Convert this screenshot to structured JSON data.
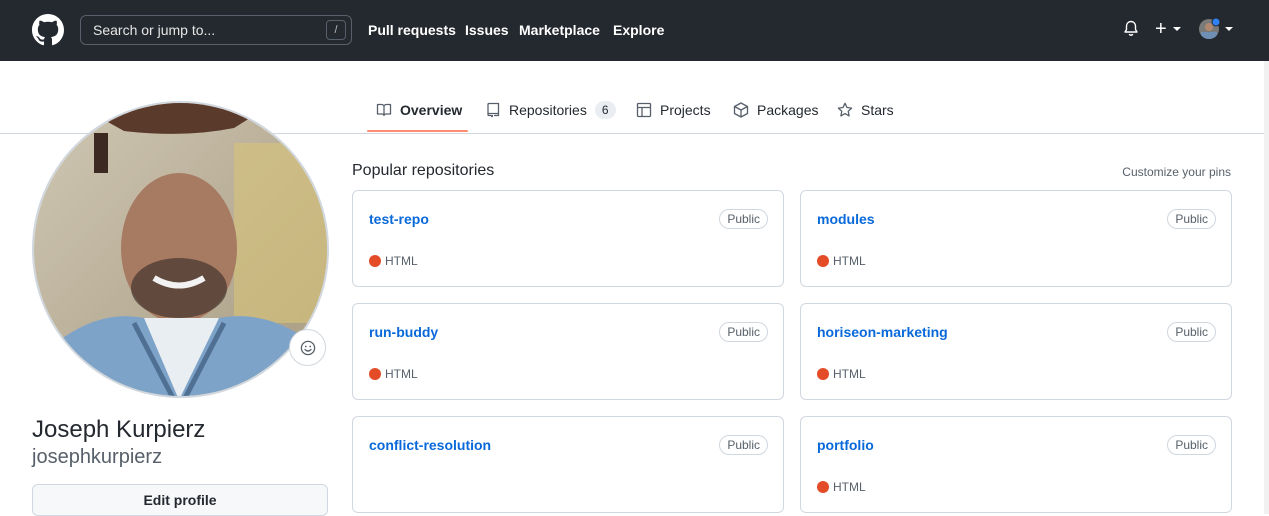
{
  "header": {
    "search_placeholder": "Search or jump to...",
    "search_shortcut": "/",
    "nav": [
      "Pull requests",
      "Issues",
      "Marketplace",
      "Explore"
    ],
    "plus_label": "+"
  },
  "tabs": [
    {
      "label": "Overview",
      "icon": "book-icon",
      "active": true
    },
    {
      "label": "Repositories",
      "icon": "repo-icon",
      "count": "6"
    },
    {
      "label": "Projects",
      "icon": "project-icon"
    },
    {
      "label": "Packages",
      "icon": "package-icon"
    },
    {
      "label": "Stars",
      "icon": "star-icon"
    }
  ],
  "profile": {
    "full_name": "Joseph Kurpierz",
    "username": "josephkurpierz",
    "edit_label": "Edit profile"
  },
  "popular": {
    "title": "Popular repositories",
    "customize": "Customize your pins",
    "repos": [
      {
        "name": "test-repo",
        "visibility": "Public",
        "language": "HTML"
      },
      {
        "name": "modules",
        "visibility": "Public",
        "language": "HTML"
      },
      {
        "name": "run-buddy",
        "visibility": "Public",
        "language": "HTML"
      },
      {
        "name": "horiseon-marketing",
        "visibility": "Public",
        "language": "HTML"
      },
      {
        "name": "conflict-resolution",
        "visibility": "Public",
        "language": ""
      },
      {
        "name": "portfolio",
        "visibility": "Public",
        "language": "HTML"
      }
    ]
  },
  "colors": {
    "header_bg": "#24292f",
    "link": "#0969da",
    "html_lang": "#e34c26",
    "tab_active": "#fd8c73"
  }
}
